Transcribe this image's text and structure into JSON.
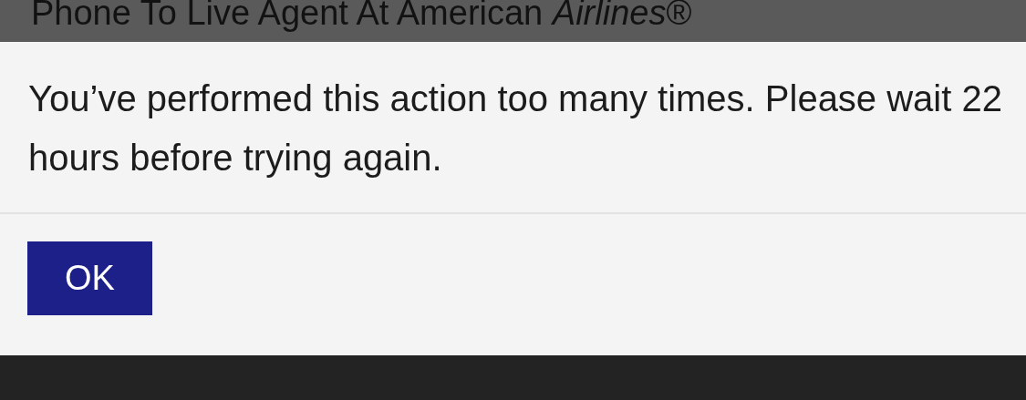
{
  "background_heading": "Phone To Live Agent At American *Airlines*®",
  "dialog": {
    "message": "You’ve performed this action too many times. Please wait 22 hours before trying again.",
    "buttons": [
      "OK"
    ]
  }
}
